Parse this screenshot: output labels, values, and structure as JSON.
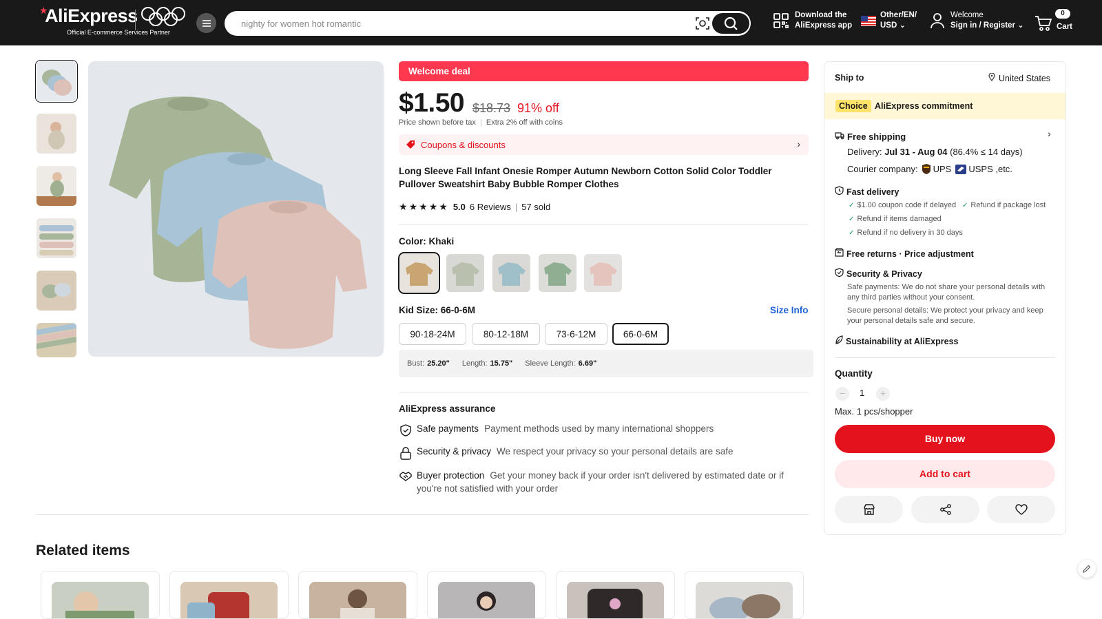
{
  "header": {
    "logo_text": "AliExpress",
    "logo_subtitle": "Official E-commerce Services Partner",
    "search_placeholder": "nighty for women hot romantic",
    "download_line1": "Download the",
    "download_line2": "AliExpress app",
    "locale_line1": "Other/EN/",
    "locale_line2": "USD",
    "account_line1": "Welcome",
    "account_line2": "Sign in / Register",
    "cart_count": "0",
    "cart_label": "Cart",
    "icons": [
      "menu-icon",
      "camera-search-icon",
      "search-icon",
      "qr-code-icon",
      "us-flag-icon",
      "user-icon",
      "cart-icon"
    ]
  },
  "product": {
    "deal_banner": "Welcome deal",
    "price": "$1.50",
    "original_price": "$18.73",
    "discount": "91% off",
    "tax_note": "Price shown before tax",
    "coins_note": "Extra 2% off with coins",
    "coupons_label": "Coupons & discounts",
    "title": "Long Sleeve Fall Infant Onesie Romper Autumn Newborn Cotton Solid Color Toddler Pullover Sweatshirt Baby Bubble Romper Clothes",
    "rating": "5.0",
    "stars": 5,
    "reviews": "6 Reviews",
    "sold": "57 sold",
    "color_label": "Color: Khaki",
    "swatches": [
      "khaki",
      "grey-green",
      "light-blue",
      "green",
      "pink"
    ],
    "size_label": "Kid Size: 66-0-6M",
    "size_info": "Size Info",
    "sizes": [
      "90-18-24M",
      "80-12-18M",
      "73-6-12M",
      "66-0-6M"
    ],
    "selected_size": "66-0-6M",
    "measurements": [
      {
        "label": "Bust:",
        "value": "25.20\""
      },
      {
        "label": "Length:",
        "value": "15.75\""
      },
      {
        "label": "Sleeve Length:",
        "value": "6.69\""
      }
    ]
  },
  "assurance": {
    "title": "AliExpress assurance",
    "items": [
      {
        "key": "Safe payments",
        "value": "Payment methods used by many international shoppers"
      },
      {
        "key": "Security & privacy",
        "value": "We respect your privacy so your personal details are safe"
      },
      {
        "key": "Buyer protection",
        "value": "Get your money back if your order isn't delivered by estimated date or if you're not satisfied with your order"
      }
    ]
  },
  "panel": {
    "ship_to_label": "Ship to",
    "ship_to_value": "United States",
    "choice_tag": "Choice",
    "commitment": "AliExpress commitment",
    "free_shipping": "Free shipping",
    "delivery_label": "Delivery:",
    "delivery_value": "Jul 31 - Aug 04",
    "delivery_rate": "(86.4% ≤ 14 days)",
    "courier_label": "Courier company:",
    "courier_ups": "UPS",
    "courier_usps": "USPS ,etc.",
    "fast_delivery": "Fast delivery",
    "fd_items": [
      "$1.00 coupon code if delayed",
      "Refund if package lost",
      "Refund if items damaged",
      "Refund if no delivery in 30 days"
    ],
    "free_returns": "Free returns · Price adjustment",
    "security_title": "Security & Privacy",
    "security_text1": "Safe payments: We do not share your personal details with any third parties without your consent.",
    "security_text2": "Secure personal details: We protect your privacy and keep your personal details safe and secure.",
    "sustainability": "Sustainability at AliExpress",
    "quantity_label": "Quantity",
    "quantity_value": "1",
    "qty_minus": "−",
    "qty_plus": "+",
    "max_note": "Max. 1 pcs/shopper",
    "buy_now": "Buy now",
    "add_to_cart": "Add to cart"
  },
  "related": {
    "title": "Related items",
    "colors": [
      "#8aa27c",
      "#b4342f",
      "#c8b3a0",
      "#6f6e74",
      "#3b3533",
      "#a7b7c6"
    ]
  }
}
